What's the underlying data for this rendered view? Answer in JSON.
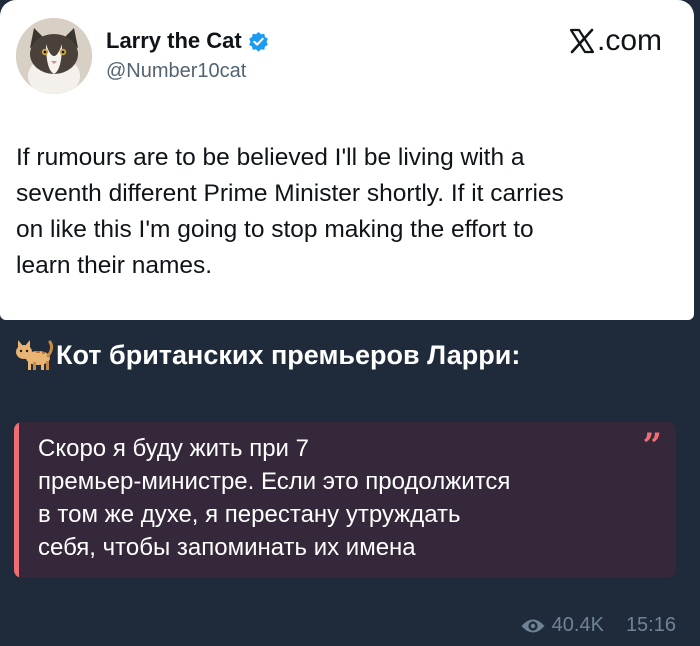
{
  "tweet": {
    "author_name": "Larry the Cat",
    "author_handle": "@Number10cat",
    "source": ".com",
    "source_icon": "x-logo-icon",
    "text": "If rumours are to be believed I'll be living with a\nseventh different Prime Minister shortly. If it carries\non like this I'm going to stop making the effort to\nlearn their names."
  },
  "caption": {
    "icon": "cat-emoji-icon",
    "text": "Кот британских премьеров Ларри:"
  },
  "quote": {
    "text": "Скоро я буду жить при 7\nпремьер-министре. Если это продолжится\nв том же духе, я перестану утруждать\nсебя, чтобы запоминать их имена"
  },
  "meta": {
    "views": "40.4K",
    "time": "15:16"
  },
  "colors": {
    "background": "#1f2b3a",
    "verified": "#1d9bf0",
    "quote_accent": "#ee6e73",
    "quote_bg": "#34283a"
  }
}
